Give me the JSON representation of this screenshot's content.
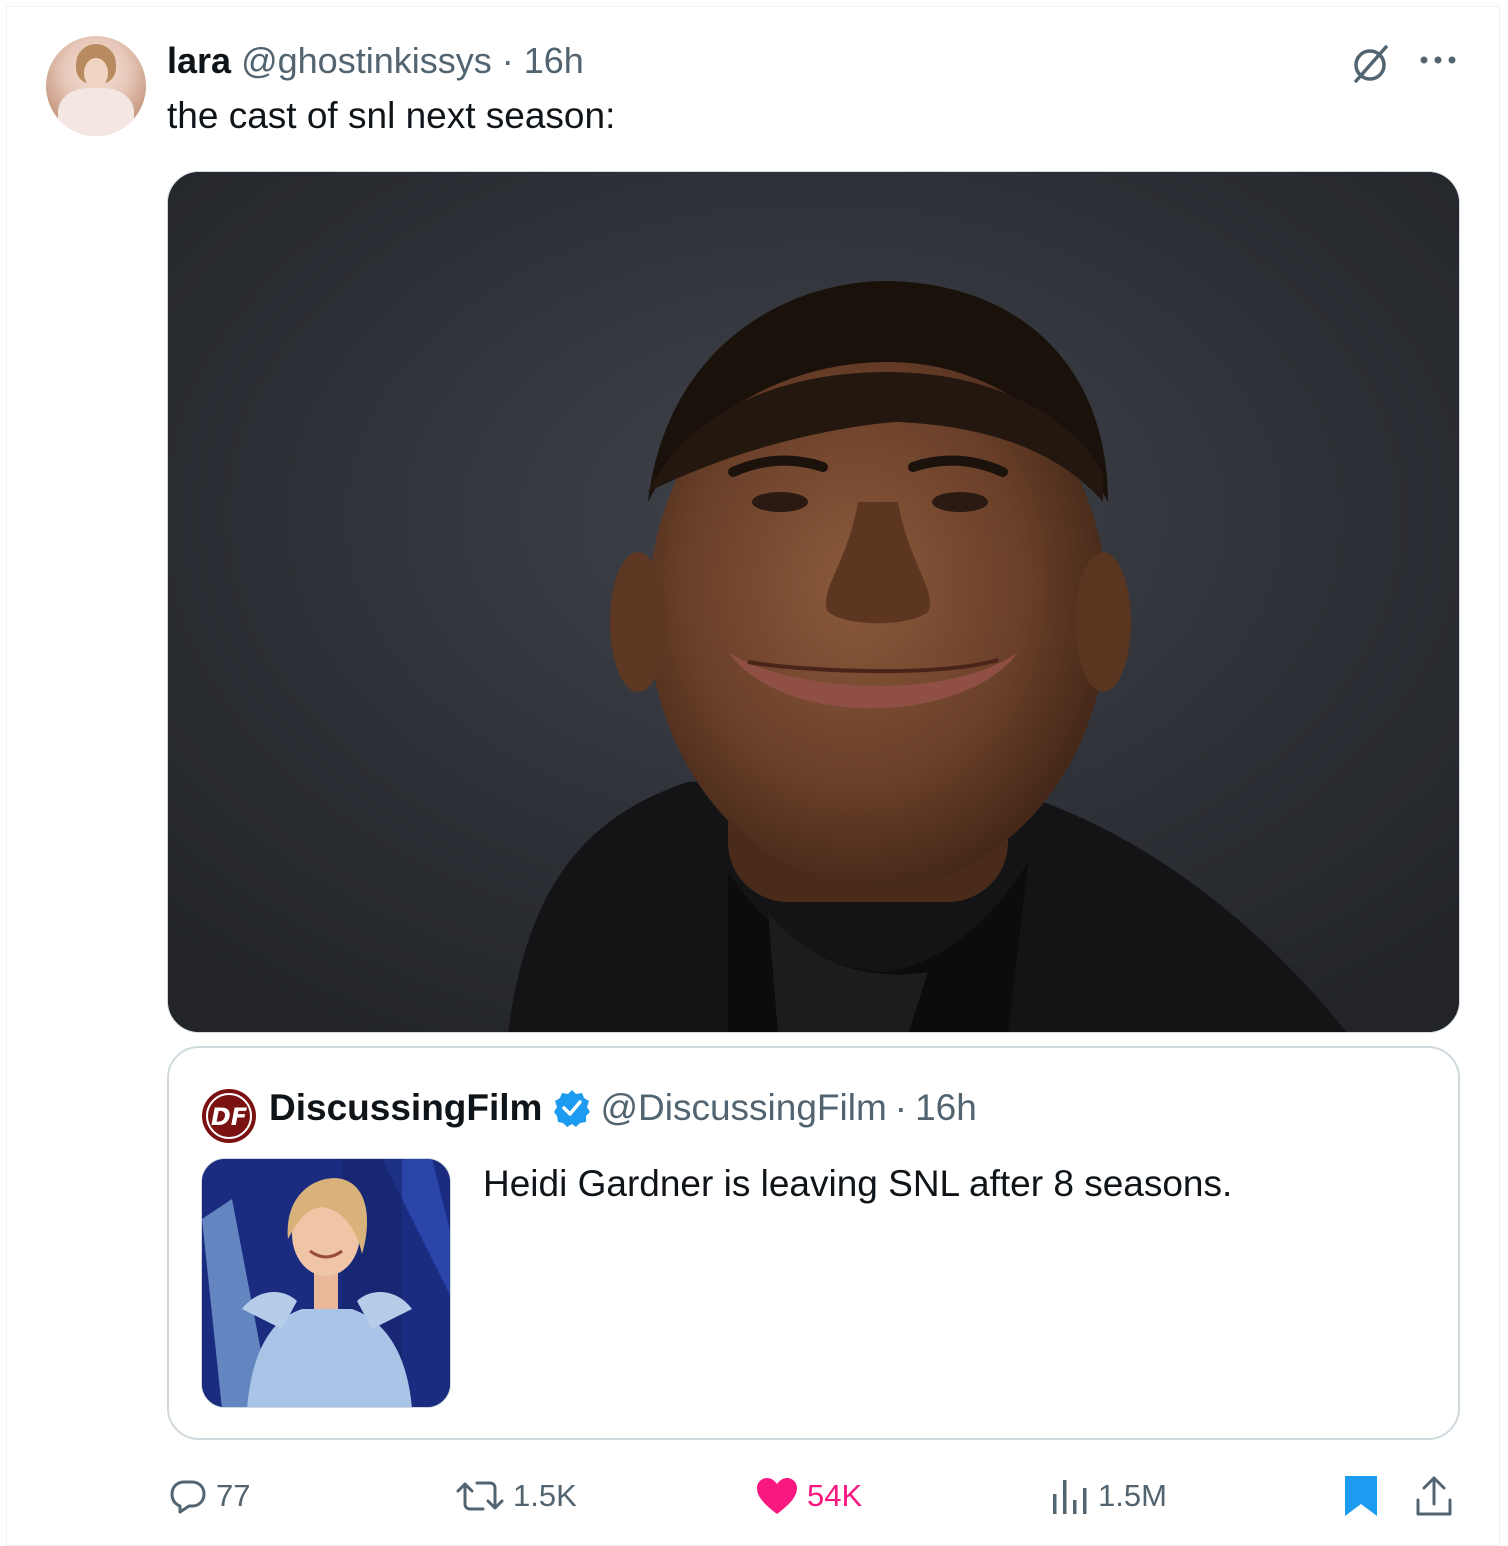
{
  "tweet": {
    "author_name": "lara",
    "author_handle": "@ghostinkissys",
    "separator": "·",
    "time": "16h",
    "text": "the cast of snl next season:",
    "media_icon": "photo-portrait"
  },
  "quoted_tweet": {
    "author_name": "DiscussingFilm",
    "author_handle": "@DiscussingFilm",
    "separator": "·",
    "time": "16h",
    "text": "Heidi Gardner is leaving SNL after 8 seasons.",
    "logo_text": "DF",
    "verified_color": "#1d9bf0"
  },
  "actions": {
    "replies": "77",
    "reposts": "1.5K",
    "likes": "54K",
    "views": "1.5M"
  },
  "colors": {
    "text_primary": "#0f1419",
    "text_secondary": "#536471",
    "like": "#f91880",
    "bookmark": "#1d9bf0",
    "border": "#cfd9de"
  },
  "icons": [
    "grok-icon",
    "more-icon",
    "verified-icon",
    "reply-icon",
    "repost-icon",
    "heart-icon",
    "views-icon",
    "bookmark-icon",
    "share-icon"
  ]
}
